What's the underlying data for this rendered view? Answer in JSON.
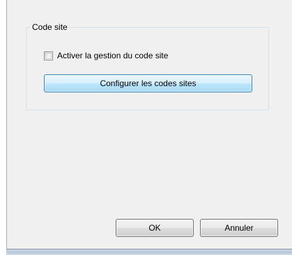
{
  "group": {
    "title": "Code site",
    "checkbox_label": "Activer la gestion du code site",
    "checkbox_checked": false,
    "configure_button_label": "Configurer les codes sites"
  },
  "footer": {
    "ok_label": "OK",
    "cancel_label": "Annuler"
  }
}
